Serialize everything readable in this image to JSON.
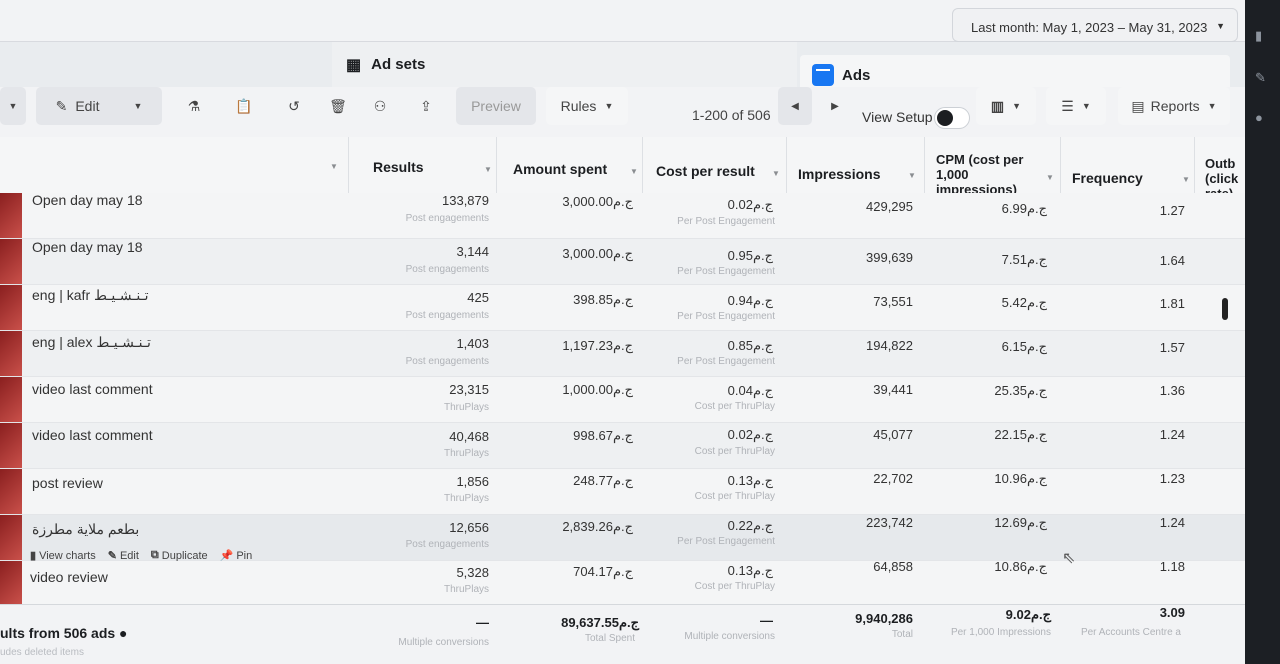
{
  "date_range": "Last month: May 1, 2023 – May 31, 2023",
  "tabs": {
    "adsets": "Ad sets",
    "ads": "Ads"
  },
  "toolbar": {
    "edit": "Edit",
    "preview": "Preview",
    "rules": "Rules",
    "pager": "1-200 of 506",
    "view_setup": "View Setup",
    "reports": "Reports"
  },
  "columns": {
    "results": "Results",
    "amount_spent": "Amount spent",
    "cost_per_result": "Cost per result",
    "impressions": "Impressions",
    "cpm": "CPM (cost per 1,000 impressions)",
    "cpm_l1": "CPM (cost per",
    "cpm_l2": "1,000",
    "cpm_l3": "impressions)",
    "frequency": "Frequency",
    "outbound_l1": "Outb",
    "outbound_l2": "(click",
    "outbound_l3": "rate)"
  },
  "rows": [
    {
      "name": "Open day may 18",
      "results": "133,879",
      "results_type": "Post engagements",
      "spent": "3,000.00ج.م",
      "cpr": "0.02ج.م",
      "cpr_type": "Per Post Engagement",
      "impressions": "429,295",
      "cpm": "6.99ج.م",
      "frequency": "1.27"
    },
    {
      "name": "Open day may 18",
      "results": "3,144",
      "results_type": "Post engagements",
      "spent": "3,000.00ج.م",
      "cpr": "0.95ج.م",
      "cpr_type": "Per Post Engagement",
      "impressions": "399,639",
      "cpm": "7.51ج.م",
      "frequency": "1.64"
    },
    {
      "name": "eng | kafr تـنـشـيـط",
      "results": "425",
      "results_type": "Post engagements",
      "spent": "398.85ج.م",
      "cpr": "0.94ج.م",
      "cpr_type": "Per Post Engagement",
      "impressions": "73,551",
      "cpm": "5.42ج.م",
      "frequency": "1.81"
    },
    {
      "name": "eng | alex تـنـشـيـط",
      "results": "1,403",
      "results_type": "Post engagements",
      "spent": "1,197.23ج.م",
      "cpr": "0.85ج.م",
      "cpr_type": "Per Post Engagement",
      "impressions": "194,822",
      "cpm": "6.15ج.م",
      "frequency": "1.57"
    },
    {
      "name": "video last comment",
      "results": "23,315",
      "results_type": "ThruPlays",
      "spent": "1,000.00ج.م",
      "cpr": "0.04ج.م",
      "cpr_type": "Cost per ThruPlay",
      "impressions": "39,441",
      "cpm": "25.35ج.م",
      "frequency": "1.36"
    },
    {
      "name": "video last comment",
      "results": "40,468",
      "results_type": "ThruPlays",
      "spent": "998.67ج.م",
      "cpr": "0.02ج.م",
      "cpr_type": "Cost per ThruPlay",
      "impressions": "45,077",
      "cpm": "22.15ج.م",
      "frequency": "1.24"
    },
    {
      "name": "post review",
      "results": "1,856",
      "results_type": "ThruPlays",
      "spent": "248.77ج.م",
      "cpr": "0.13ج.م",
      "cpr_type": "Cost per ThruPlay",
      "impressions": "22,702",
      "cpm": "10.96ج.م",
      "frequency": "1.23"
    },
    {
      "name": "بطعم ملاية مطرزة",
      "results": "12,656",
      "results_type": "Post engagements",
      "spent": "2,839.26ج.م",
      "cpr": "0.22ج.م",
      "cpr_type": "Per Post Engagement",
      "impressions": "223,742",
      "cpm": "12.69ج.م",
      "frequency": "1.24"
    },
    {
      "name": "video review",
      "results": "5,328",
      "results_type": "ThruPlays",
      "spent": "704.17ج.م",
      "cpr": "0.13ج.م",
      "cpr_type": "Cost per ThruPlay",
      "impressions": "64,858",
      "cpm": "10.86ج.م",
      "frequency": "1.18"
    }
  ],
  "row_actions": {
    "view_charts": "View charts",
    "edit": "Edit",
    "duplicate": "Duplicate",
    "pin": "Pin"
  },
  "totals": {
    "title": "ults from 506 ads",
    "subtitle": "udes deleted items",
    "results": "—",
    "results_label": "Multiple conversions",
    "spent": "89,637.55ج.م",
    "spent_label": "Total Spent",
    "cpr": "—",
    "cpr_label": "Multiple conversions",
    "impressions": "9,940,286",
    "impressions_label": "Total",
    "cpm": "9.02ج.م",
    "cpm_label": "Per 1,000 Impressions",
    "frequency": "3.09",
    "frequency_label": "Per Accounts Centre a"
  }
}
